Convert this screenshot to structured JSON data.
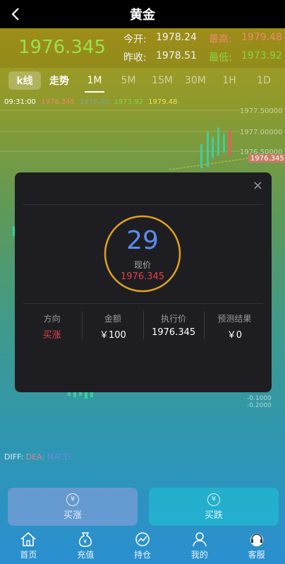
{
  "header": {
    "title": "黄金"
  },
  "quote": {
    "price": "1976.345",
    "open_label": "今开:",
    "open_value": "1978.24",
    "high_label": "最高:",
    "high_value": "1979.48",
    "prev_label": "昨收:",
    "prev_value": "1978.51",
    "low_label": "最低:",
    "low_value": "1973.92"
  },
  "tabs": {
    "kline": "k线",
    "trend": "走势",
    "periods": [
      "1M",
      "5M",
      "15M",
      "30M",
      "1H",
      "1D"
    ]
  },
  "ohlc": {
    "time": "09:31:00",
    "open": "1976.345",
    "close": "1975.40",
    "low": "1973.92",
    "high": "1979.48"
  },
  "chart_axis": {
    "y_labels": [
      "1977.50000",
      "1977.00000",
      "1976.50000"
    ],
    "current_tag": "1976.345",
    "lower_labels": [
      "-0.1000",
      "-0.2000"
    ]
  },
  "diff_line": {
    "diff": "DIFF:",
    "dea": "DEA:",
    "macd": "MACD:"
  },
  "modal": {
    "close_glyph": "×",
    "countdown": "29",
    "current_label": "现价",
    "current_value": "1976.345",
    "columns": [
      {
        "label": "方向",
        "value": "买涨"
      },
      {
        "label": "金额",
        "value": "￥100"
      },
      {
        "label": "执行价",
        "value": "1976.345"
      },
      {
        "label": "预测结果",
        "value": "￥0"
      }
    ]
  },
  "actions": {
    "buy_up": "买涨",
    "buy_down": "买跌",
    "coin_glyph": "¥"
  },
  "nav": {
    "items": [
      {
        "label": "首页",
        "icon": "home-icon"
      },
      {
        "label": "充值",
        "icon": "money-bag-icon"
      },
      {
        "label": "持仓",
        "icon": "chart-icon"
      },
      {
        "label": "我的",
        "icon": "user-icon"
      },
      {
        "label": "客服",
        "icon": "headset-icon"
      }
    ]
  },
  "colors": {
    "up": "#e0404a",
    "countdown": "#5b8df0",
    "ring": "#e0a020",
    "price_green": "#9be04a"
  }
}
